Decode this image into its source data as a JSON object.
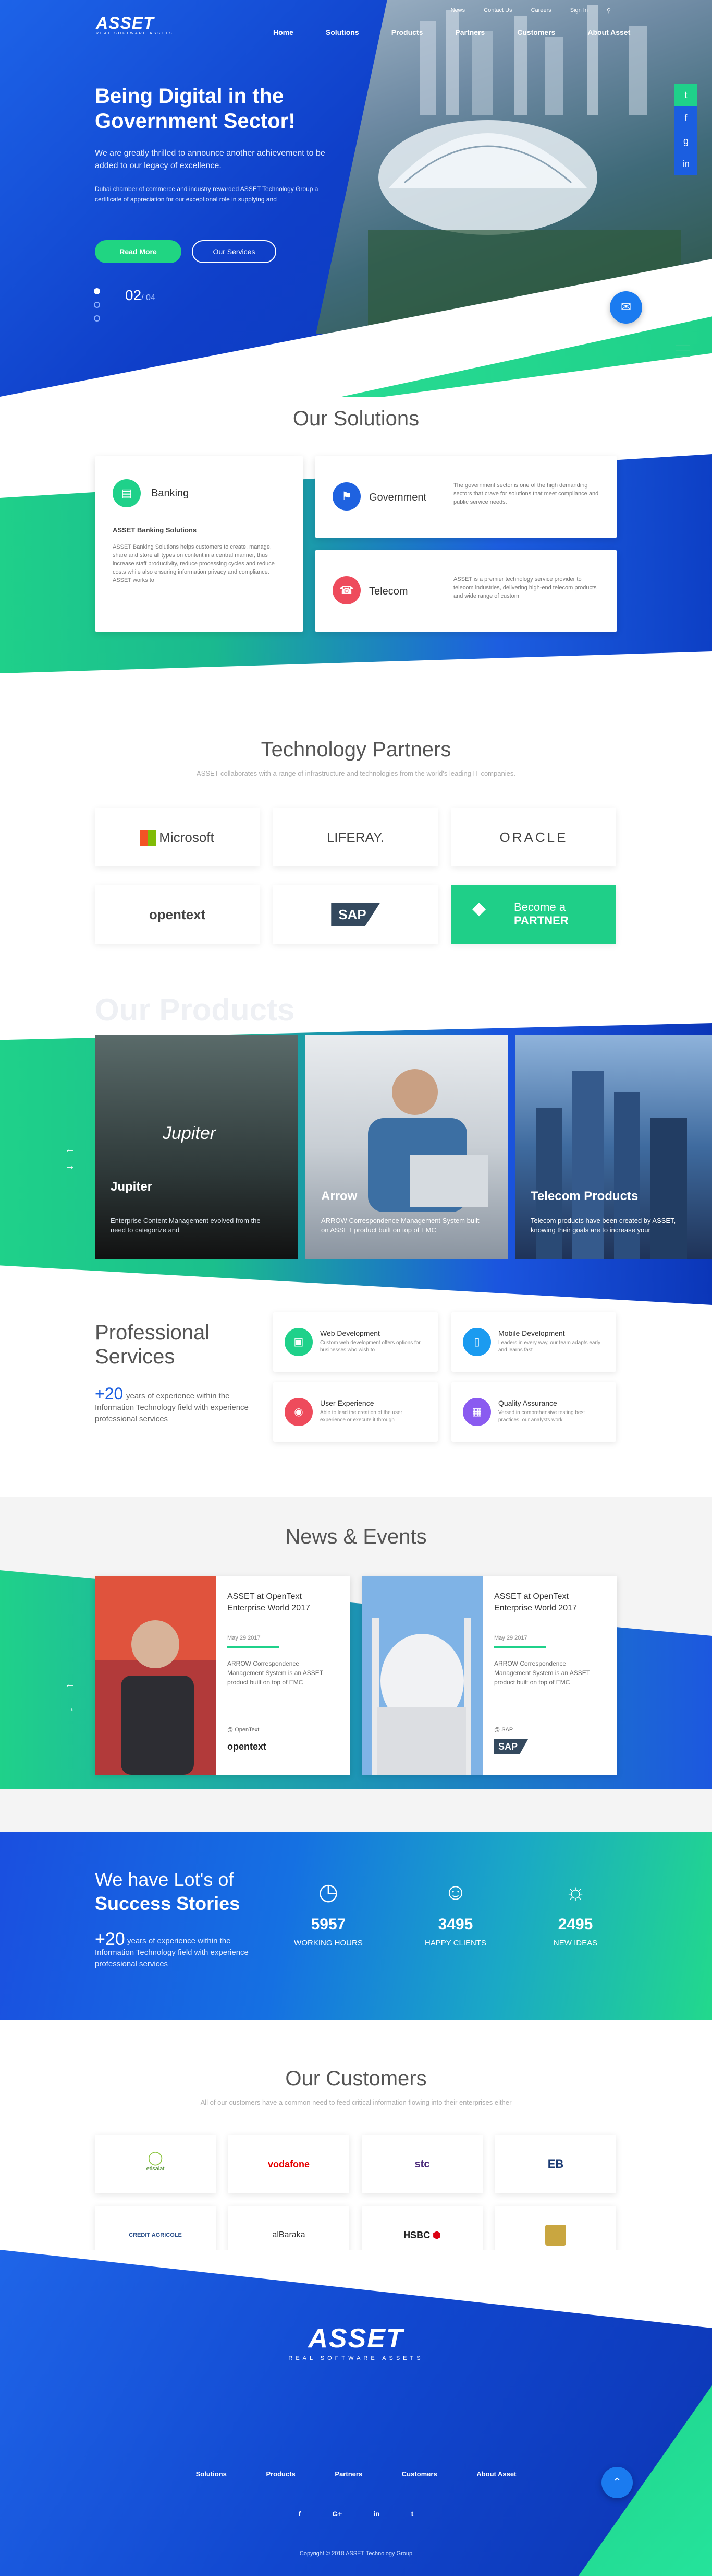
{
  "nav": {
    "brand": "ASSET",
    "brand_sub": "REAL SOFTWARE ASSETS",
    "top": [
      "News",
      "Contact Us",
      "Careers",
      "Sign In"
    ],
    "main": [
      "Home",
      "Solutions",
      "Products",
      "Partners",
      "Customers",
      "About Asset"
    ]
  },
  "hero": {
    "title": "Being Digital in the Government Sector!",
    "p1": "We are greatly thrilled to announce another achievement to be added to our legacy of excellence.",
    "p2": "Dubai chamber of commerce and industry rewarded ASSET Technology Group a certificate of appreciation for our exceptional role in supplying and",
    "btn_primary": "Read More",
    "btn_secondary": "Our Services",
    "slide_current": "02",
    "slide_total": "/ 04"
  },
  "solutions": {
    "title": "Our Solutions",
    "banking": {
      "name": "Banking",
      "heading": "ASSET Banking Solutions",
      "desc": "ASSET Banking Solutions helps customers to create, manage, share and store all types on content in a central manner, thus increase staff productivity, reduce processing cycles and reduce costs while also ensuring information privacy and compliance. ASSET works to"
    },
    "government": {
      "name": "Government",
      "desc": "The government sector is one of the high demanding sectors that crave for solutions that meet compliance and public service needs."
    },
    "telecom": {
      "name": "Telecom",
      "desc": "ASSET is a premier technology service provider to telecom industries, delivering high-end telecom products and wide range of custom"
    }
  },
  "partners": {
    "title": "Technology Partners",
    "subtitle": "ASSET collaborates with a range of infrastructure and technologies from the world's leading IT companies.",
    "items": [
      "Microsoft",
      "LIFERAY.",
      "ORACLE",
      "opentext",
      "SAP"
    ],
    "become_a": "Become a",
    "partner": "PARTNER"
  },
  "products": {
    "title": "Our Products",
    "items": [
      {
        "name": "Jupiter",
        "desc": "Enterprise Content Management evolved from the need to categorize and",
        "logo": "Jupiter"
      },
      {
        "name": "Arrow",
        "desc": "ARROW Correspondence Management System built on ASSET product built on top of EMC"
      },
      {
        "name": "Telecom Products",
        "desc": "Telecom products have been created by ASSET, knowing their goals are to increase your"
      }
    ]
  },
  "services": {
    "title1": "Professional",
    "title2": "Services",
    "num": "+20",
    "text": "years of experience within the Information Technology field with experience professional services",
    "items": [
      {
        "t": "Web Development",
        "d": "Custom web development offers options for businesses who wish to"
      },
      {
        "t": "Mobile Development",
        "d": "Leaders in every way, our team adapts early and learns fast"
      },
      {
        "t": "User Experience",
        "d": "Able to lead the creation of the user experience or execute it through"
      },
      {
        "t": "Quality Assurance",
        "d": "Versed in comprehensive testing best practices, our analysts work"
      }
    ]
  },
  "news": {
    "title": "News & Events",
    "items": [
      {
        "title": "ASSET at OpenText Enterprise World 2017",
        "date": "May 29 2017",
        "desc": "ARROW Correspondence Management System is an ASSET product built on top of EMC",
        "tag": "@ OpenText",
        "logo": "opentext"
      },
      {
        "title": "ASSET at OpenText Enterprise World 2017",
        "date": "May 29 2017",
        "desc": "ARROW Correspondence Management System is an ASSET product built on top of EMC",
        "tag": "@ SAP",
        "logo": "SAP"
      }
    ]
  },
  "stats": {
    "line1": "We have Lot's of",
    "line2": "Success Stories",
    "num": "+20",
    "text": "years of experience within the Information Technology field with experience professional services",
    "items": [
      {
        "v": "5957",
        "l": "WORKING HOURS"
      },
      {
        "v": "3495",
        "l": "HAPPY CLIENTS"
      },
      {
        "v": "2495",
        "l": "NEW IDEAS"
      }
    ]
  },
  "customers": {
    "title": "Our Customers",
    "subtitle": "All of our customers have a common need to feed critical information flowing into their enterprises either",
    "items": [
      "etisalat",
      "vodafone",
      "stc",
      "EB",
      "CREDIT AGRICOLE",
      "alBaraka",
      "HSBC",
      "logo"
    ]
  },
  "footer": {
    "brand": "ASSET",
    "brand_sub": "REAL SOFTWARE ASSETS",
    "links": [
      "Solutions",
      "Products",
      "Partners",
      "Customers",
      "About Asset"
    ],
    "social": [
      "f",
      "G+",
      "in",
      "t"
    ],
    "copyright": "Copyright © 2018 ASSET Technology Group"
  }
}
